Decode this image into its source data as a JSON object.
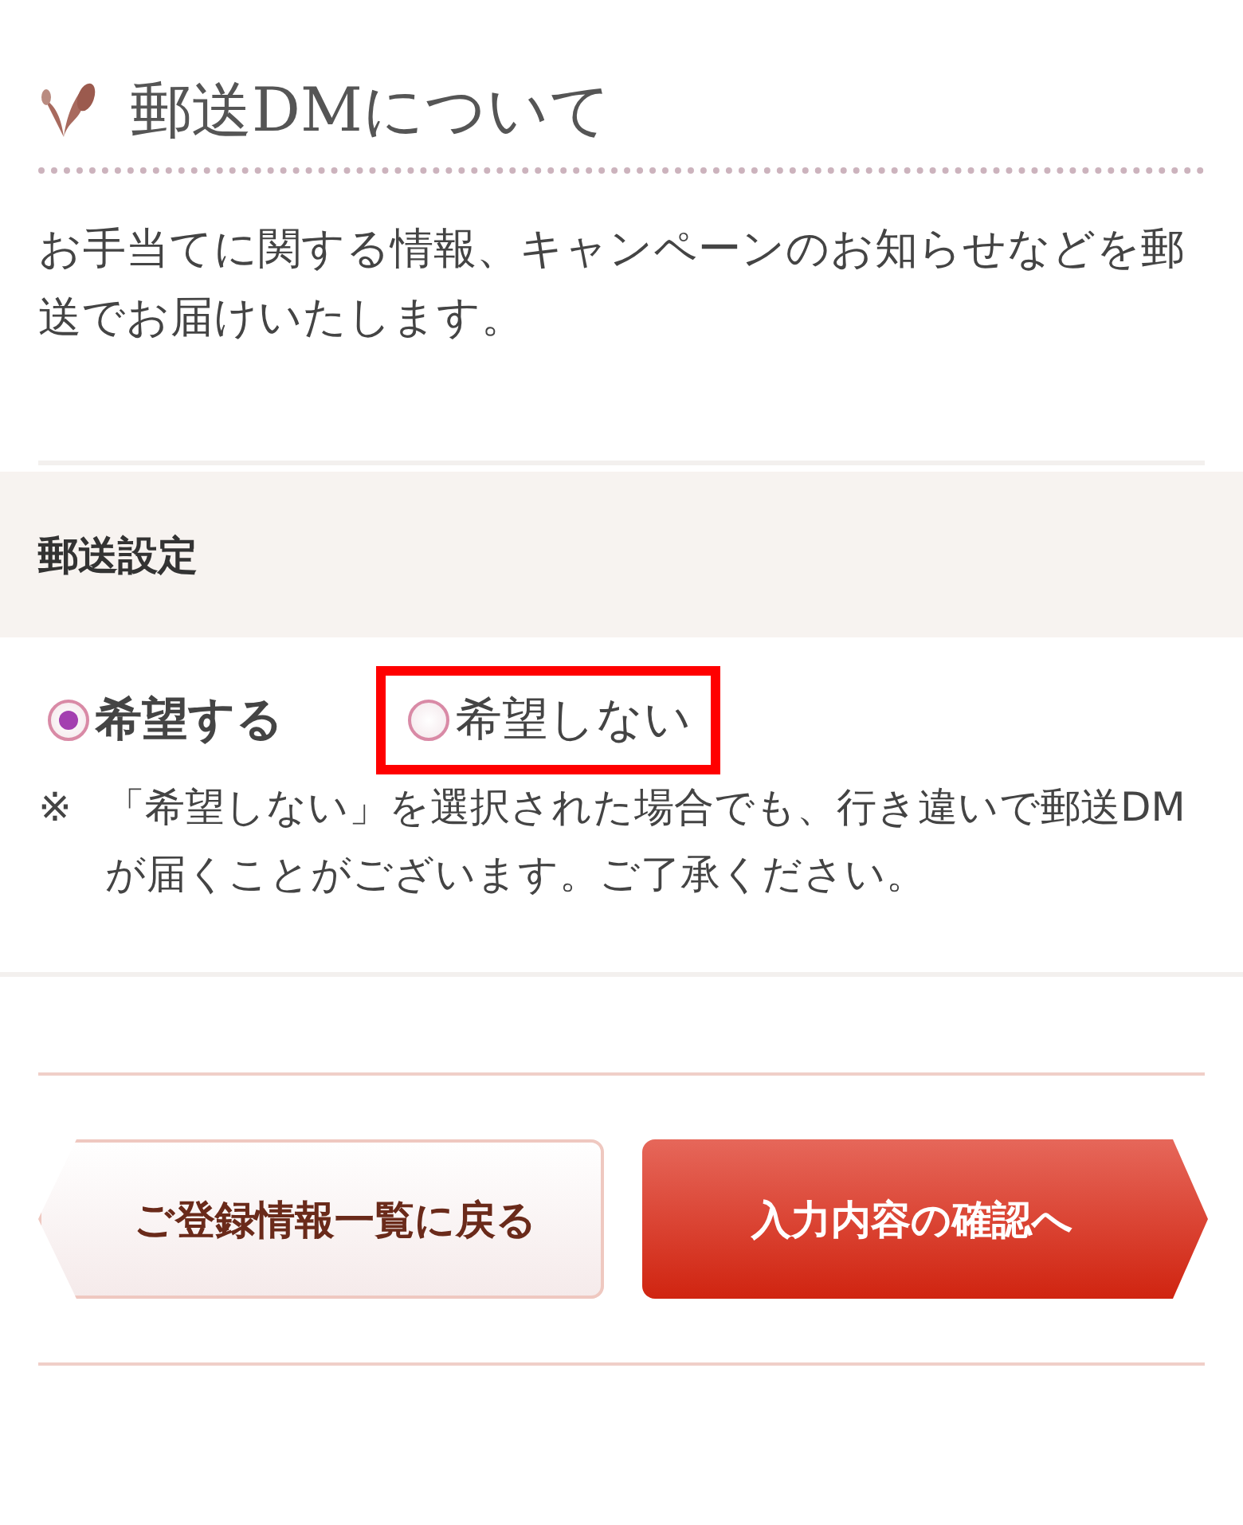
{
  "heading": {
    "title": "郵送DMについて"
  },
  "intro": "お手当てに関する情報、キャンペーンのお知らせなどを郵送でお届けいたします。",
  "section": {
    "title": "郵送設定"
  },
  "options": [
    {
      "label": "希望する",
      "selected": true,
      "highlighted": false
    },
    {
      "label": "希望しない",
      "selected": false,
      "highlighted": true
    }
  ],
  "note": {
    "mark": "※",
    "text": "「希望しない」を選択された場合でも、行き違いで郵送DMが届くことがございます。ご了承ください。"
  },
  "buttons": [
    {
      "label": "ご登録情報一覧に戻る",
      "kind": "back"
    },
    {
      "label": "入力内容の確認へ",
      "kind": "next"
    }
  ]
}
